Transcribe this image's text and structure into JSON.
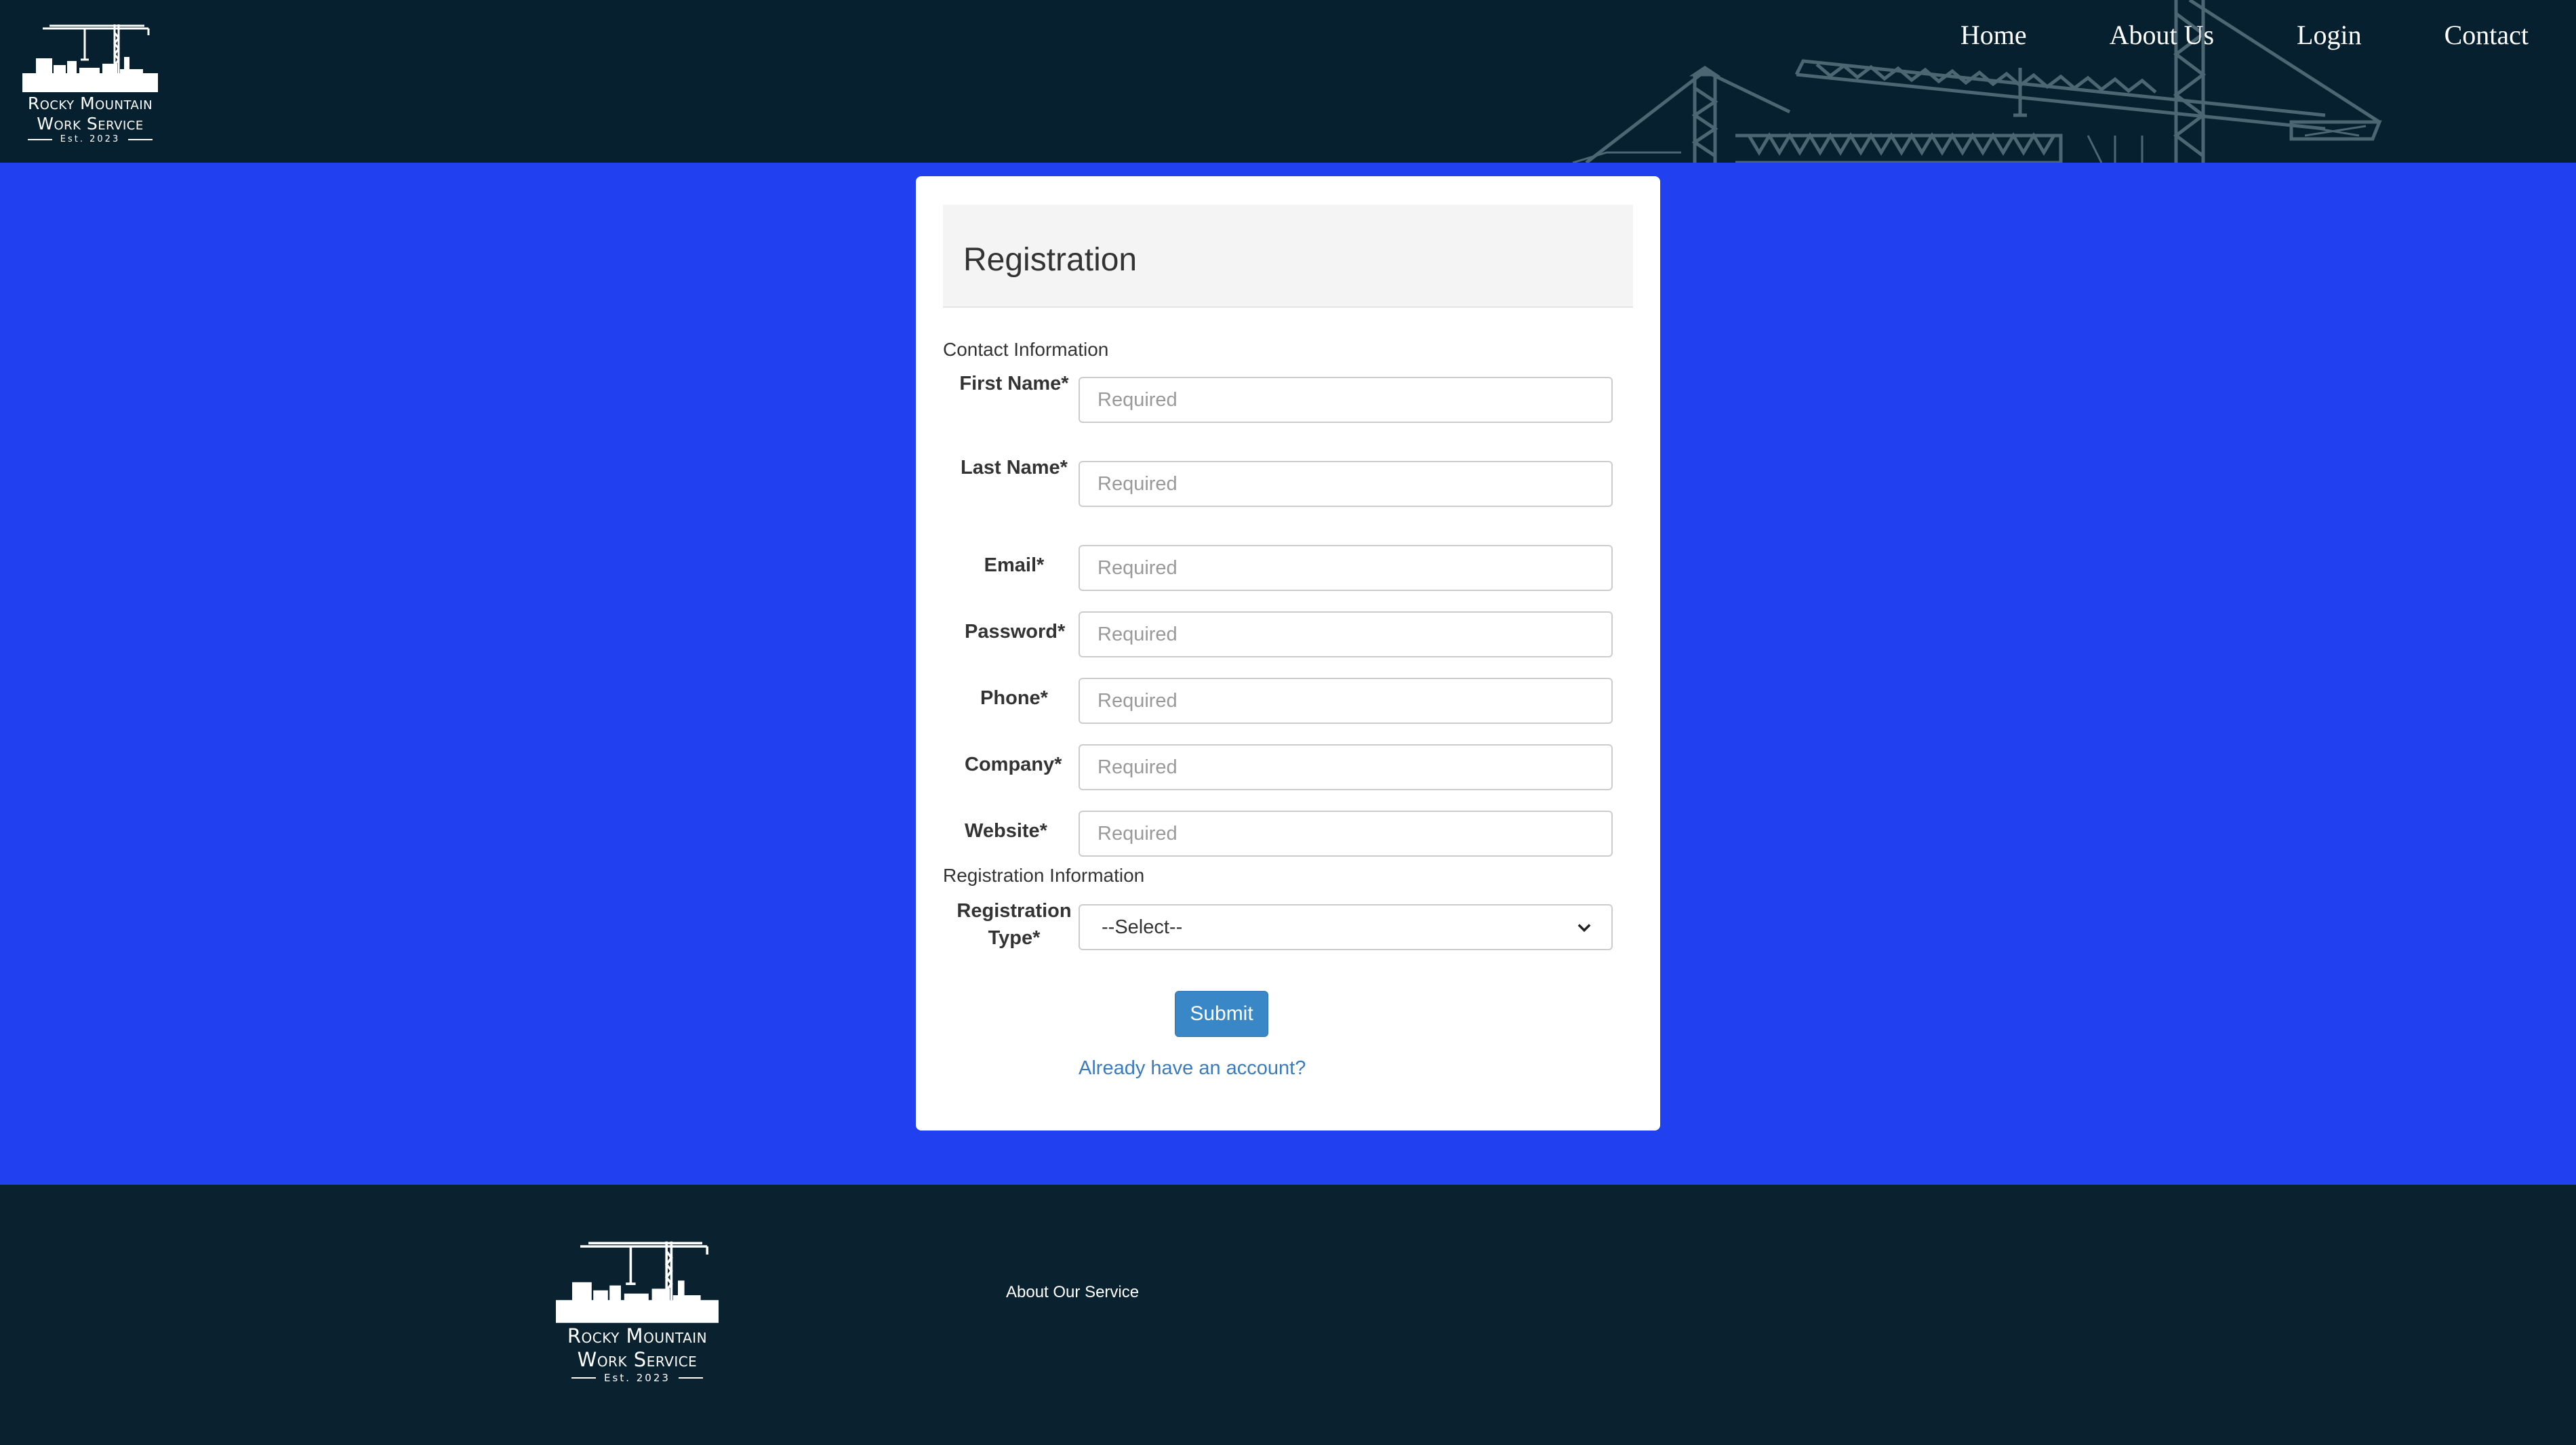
{
  "header": {
    "logo": {
      "line1": "Rocky Mountain",
      "line2": "Work Service",
      "est": "Est. 2023"
    },
    "nav": [
      {
        "label": "Home"
      },
      {
        "label": "About Us"
      },
      {
        "label": "Login"
      },
      {
        "label": "Contact"
      }
    ]
  },
  "form": {
    "title": "Registration",
    "contact_section": "Contact Information",
    "fields": [
      {
        "label": "First Name*",
        "placeholder": "Required"
      },
      {
        "label": "Last Name*",
        "placeholder": "Required"
      },
      {
        "label": "Email*",
        "placeholder": "Required"
      },
      {
        "label": "Password*",
        "placeholder": "Required"
      },
      {
        "label": "Phone*",
        "placeholder": "Required"
      },
      {
        "label": "Company*",
        "placeholder": "Required"
      },
      {
        "label": "Website*",
        "placeholder": "Required"
      }
    ],
    "registration_section": "Registration Information",
    "registration_type": {
      "label": "Registration Type*",
      "selected": "--Select--"
    },
    "submit_label": "Submit",
    "signin_link": "Already have an account?"
  },
  "footer": {
    "logo": {
      "line1": "Rocky Mountain",
      "line2": "Work Service",
      "est": "Est. 2023"
    },
    "link": "About Our Service"
  },
  "colors": {
    "header_bg": "#06202f",
    "main_bg": "#2140ef",
    "button": "#3a87c8",
    "link": "#3a7bbf"
  }
}
